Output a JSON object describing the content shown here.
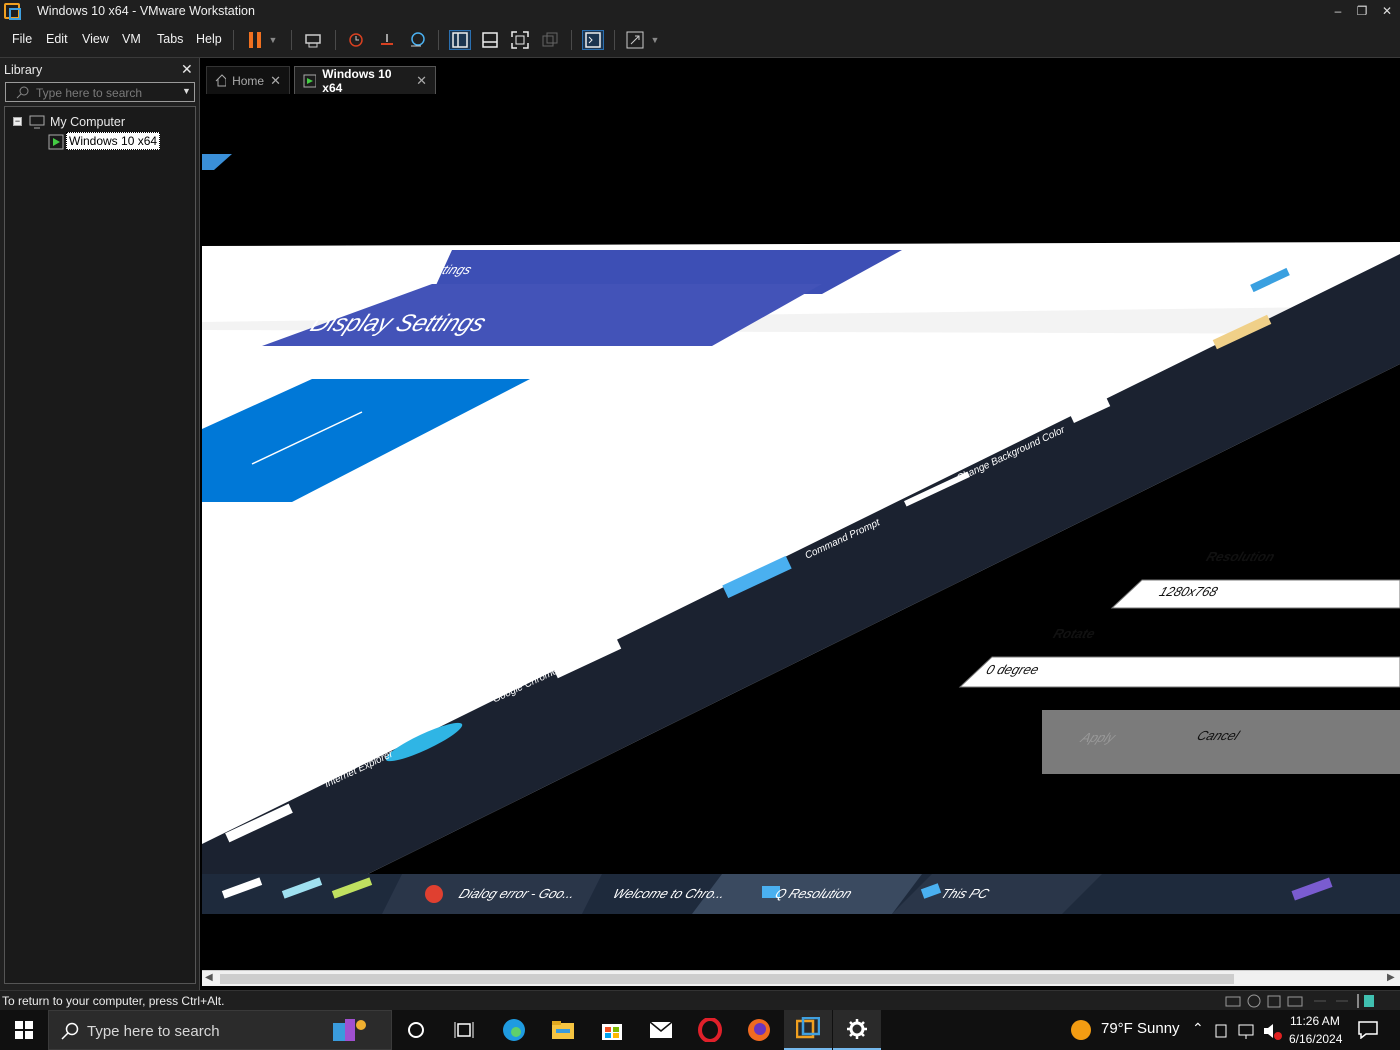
{
  "window": {
    "title": "Windows 10 x64 - VMware Workstation"
  },
  "menu": [
    "File",
    "Edit",
    "View",
    "VM",
    "Tabs",
    "Help"
  ],
  "library": {
    "title": "Library",
    "search_placeholder": "Type here to search",
    "tree": {
      "root": "My Computer",
      "child": "Windows 10 x64"
    }
  },
  "tabs": {
    "home": "Home",
    "vm": "Windows 10 x64"
  },
  "guest": {
    "settings_title": "Settings",
    "display_settings": "Display Settings",
    "resolution_label": "Resolution",
    "resolution_value": "1280x768",
    "rotate_label": "Rotate",
    "rotate_value": "0 degree",
    "apply": "Apply",
    "cancel": "Cancel",
    "sidebar": [
      "Change Background Color",
      "Command Prompt",
      "Control Panel",
      "Google Chrome",
      "Internet Explorer"
    ],
    "taskbar_items": [
      "Dialog error - Goo...",
      "Welcome to Chro...",
      "Q Resolution",
      "This PC"
    ]
  },
  "status": {
    "message": "To return to your computer, press Ctrl+Alt."
  },
  "taskbar": {
    "search_placeholder": "Type here to search",
    "weather": "79°F  Sunny",
    "time": "11:26 AM",
    "date": "6/16/2024"
  },
  "colors": {
    "accent_blue": "#3d4fb5",
    "selection": "#0078d7"
  }
}
